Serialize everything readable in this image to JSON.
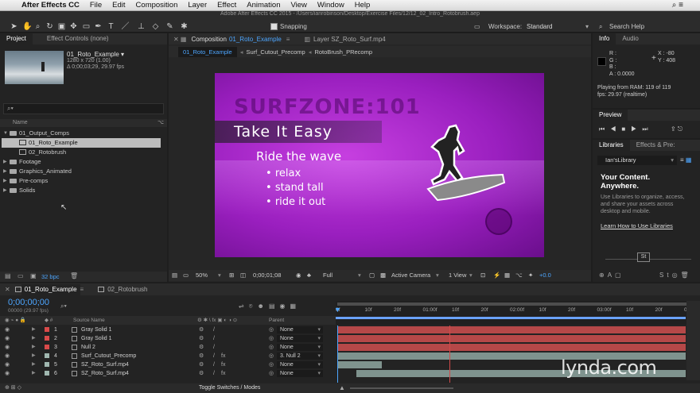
{
  "menubar": {
    "app": "After Effects CC",
    "items": [
      "File",
      "Edit",
      "Composition",
      "Layer",
      "Effect",
      "Animation",
      "View",
      "Window",
      "Help"
    ]
  },
  "window_title": "Adobe After Effects CC 2015 - /Users/ianrobinson/Desktop/Exercise Files/12/12_02_Intro_Rotobrush.aep",
  "toolbar": {
    "snapping": "Snapping",
    "workspace_label": "Workspace:",
    "workspace": "Standard",
    "search": "Search Help"
  },
  "project": {
    "tab": "Project",
    "tab2": "Effect Controls (none)",
    "item_name": "01_Roto_Example ▾",
    "item_size": "1280 x 720 (1.00)",
    "item_dur": "Δ 0;00;03;29, 29.97 fps",
    "col_name": "Name",
    "bpc": "32 bpc",
    "tree": [
      {
        "label": "01_Output_Comps",
        "type": "folder",
        "open": true,
        "indent": 0
      },
      {
        "label": "01_Roto_Example",
        "type": "comp",
        "indent": 1,
        "selected": true
      },
      {
        "label": "02_Rotobrush",
        "type": "comp",
        "indent": 1
      },
      {
        "label": "Footage",
        "type": "folder",
        "indent": 0
      },
      {
        "label": "Graphics_Animated",
        "type": "folder",
        "indent": 0
      },
      {
        "label": "Pre-comps",
        "type": "folder",
        "indent": 0
      },
      {
        "label": "Solids",
        "type": "folder",
        "indent": 0
      }
    ]
  },
  "composition": {
    "tab": "Composition",
    "tab_comp": "01_Roto_Example",
    "tab_layer": "Layer SZ_Roto_Surf.mp4",
    "crumbs": [
      "01_Roto_Example",
      "Surf_Cutout_Precomp",
      "RotoBrush_PRecomp"
    ],
    "frame": {
      "title": "SURFZONE:101",
      "banner": "Take It Easy",
      "heading": "Ride the wave",
      "bullets": [
        "relax",
        "stand tall",
        "ride it out"
      ]
    },
    "footer": {
      "zoom": "50%",
      "time": "0;00;01;08",
      "res": "Full",
      "camera": "Active Camera",
      "view": "1 View",
      "exposure": "+0.0"
    }
  },
  "info": {
    "tab": "Info",
    "tab2": "Audio",
    "r": "R :",
    "g": "G :",
    "b": "B :",
    "a": "A : 0.0000",
    "x": "X : -80",
    "y": "Y : 408",
    "ram": "Playing from RAM: 119 of 119",
    "fps": "fps: 29.97 (realtime)"
  },
  "preview": {
    "tab": "Preview"
  },
  "libraries": {
    "tab": "Libraries",
    "tab2": "Effects & Pre:",
    "library": "Ian'sLibrary",
    "headline1": "Your Content.",
    "headline2": "Anywhere.",
    "body": "Use Libraries to organize, access, and share your assets across desktop and mobile.",
    "link": "Learn How to Use Libraries"
  },
  "timeline": {
    "tabs": [
      "01_Roto_Example",
      "02_Rotobrush"
    ],
    "timecode": "0;00;00;00",
    "fps": "00000 (29.97 fps)",
    "col_source": "Source Name",
    "col_parent": "Parent",
    "toggle": "Toggle Switches / Modes",
    "ruler": [
      "0f",
      "10f",
      "20f",
      "01:00f",
      "10f",
      "20f",
      "02:00f",
      "10f",
      "20f",
      "03:00f",
      "10f",
      "20f",
      "04"
    ],
    "layers": [
      {
        "num": "1",
        "name": "Gray Solid 1",
        "color": "#d94a4a",
        "parent": "None",
        "fx": false
      },
      {
        "num": "2",
        "name": "Gray Solid 1",
        "color": "#d94a4a",
        "parent": "None",
        "fx": false
      },
      {
        "num": "3",
        "name": "Null 2",
        "color": "#d94a4a",
        "parent": "None",
        "fx": false
      },
      {
        "num": "4",
        "name": "Surf_Cutout_Precomp",
        "color": "#a0b8b0",
        "parent": "3. Null 2",
        "fx": true
      },
      {
        "num": "5",
        "name": "SZ_Roto_Surf.mp4",
        "color": "#a0b8b0",
        "parent": "None",
        "fx": true
      },
      {
        "num": "6",
        "name": "SZ_Roto_Surf.mp4",
        "color": "#a0b8b0",
        "parent": "None",
        "fx": true
      }
    ]
  },
  "watermark": "lynda.com"
}
